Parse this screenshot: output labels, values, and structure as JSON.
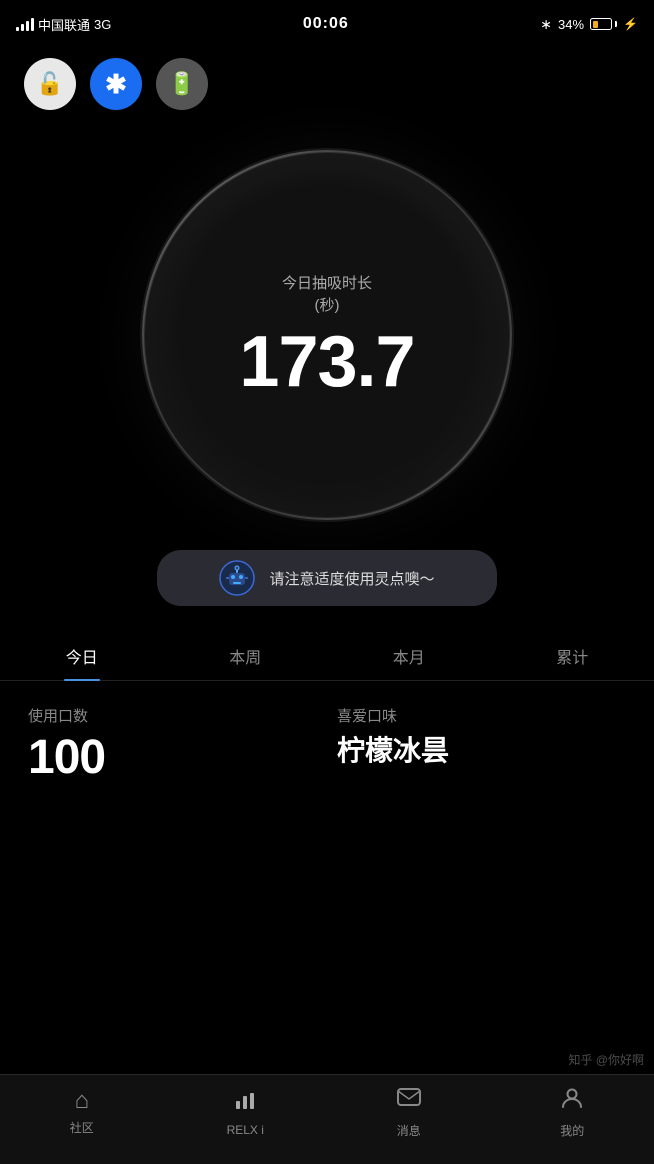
{
  "statusBar": {
    "carrier": "中国联通",
    "network": "3G",
    "time": "00:06",
    "bluetooth": "⁴",
    "battery_pct": "34%"
  },
  "quickActions": {
    "lock_label": "🔓",
    "bluetooth_label": "⁴",
    "battery_label": "🔋"
  },
  "circleDisplay": {
    "subtitle_line1": "今日抽吸时长",
    "subtitle_line2": "(秒)",
    "value": "173.7"
  },
  "notification": {
    "text": "请注意适度使用灵点噢～"
  },
  "tabs": [
    {
      "label": "今日",
      "active": true
    },
    {
      "label": "本周",
      "active": false
    },
    {
      "label": "本月",
      "active": false
    },
    {
      "label": "累计",
      "active": false
    }
  ],
  "stats": {
    "left_label": "使用口数",
    "left_value": "100",
    "right_label": "喜爱口味",
    "right_value": "柠檬冰昙"
  },
  "bottomBar": {
    "tabs": [
      {
        "label": "社区",
        "icon": "🏠",
        "active": false
      },
      {
        "label": "RELX i",
        "icon": "📊",
        "active": false
      },
      {
        "label": "消息",
        "icon": "💬",
        "active": false
      },
      {
        "label": "我的",
        "icon": "👤",
        "active": false
      }
    ]
  },
  "watermark": "知乎 @你好啊"
}
